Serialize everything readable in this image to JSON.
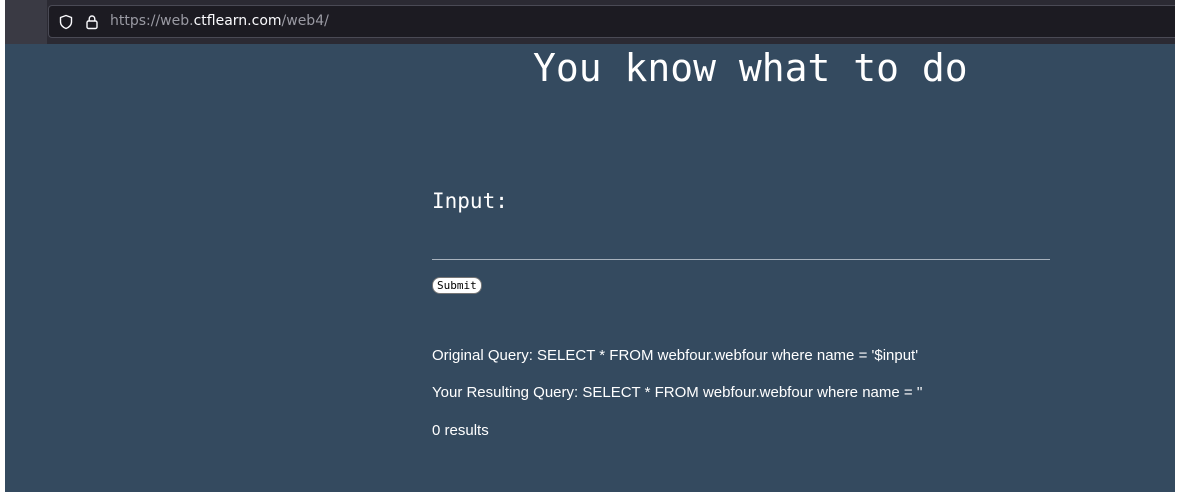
{
  "browser": {
    "url_prefix": "https://web.",
    "url_domain": "ctflearn.com",
    "url_path": "/web4/"
  },
  "page": {
    "heading": "You know what to do",
    "input_label": "Input:",
    "input_value": "",
    "submit_label": "Submit",
    "original_query": "Original Query: SELECT * FROM webfour.webfour where name = '$input'",
    "resulting_query": "Your Resulting Query: SELECT * FROM webfour.webfour where name = ''",
    "result_count": "0 results"
  },
  "colors": {
    "page_background": "#344a5f",
    "browser_toolbar": "#2b2a33",
    "url_field": "#1c1b22",
    "text": "#ffffff"
  },
  "icons": [
    "shield-icon",
    "lock-icon"
  ]
}
